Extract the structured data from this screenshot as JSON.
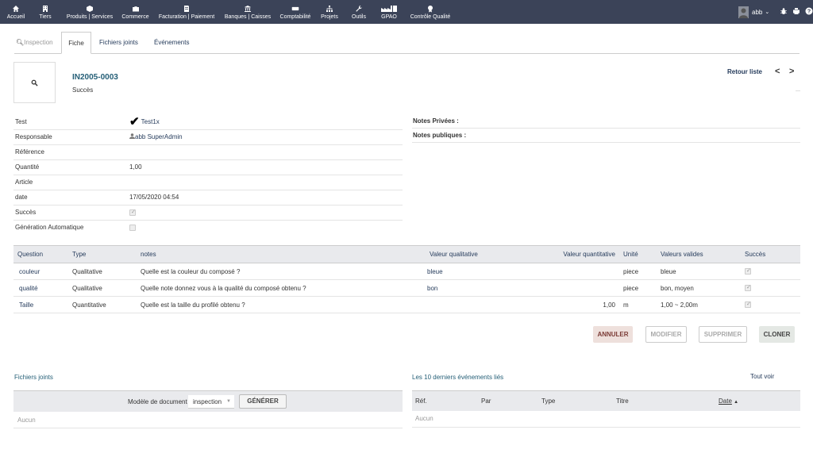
{
  "topmenu": [
    {
      "label": "Accueil",
      "icon": "home-icon"
    },
    {
      "label": "Tiers",
      "icon": "building-icon"
    },
    {
      "label": "Produits | Services",
      "icon": "cube-icon"
    },
    {
      "label": "Commerce",
      "icon": "briefcase-icon"
    },
    {
      "label": "Facturation | Paiement",
      "icon": "invoice-icon"
    },
    {
      "label": "Banques | Caisses",
      "icon": "bank-icon"
    },
    {
      "label": "Comptabilité",
      "icon": "accounting-icon"
    },
    {
      "label": "Projets",
      "icon": "sitemap-icon"
    },
    {
      "label": "Outils",
      "icon": "wrench-icon"
    },
    {
      "label": "GPAO",
      "icon": "factory-icon"
    },
    {
      "label": "Contrôle Qualité",
      "icon": "quality-icon"
    }
  ],
  "user": {
    "name": "abb"
  },
  "tabs": [
    "Inspection",
    "Fiche",
    "Fichiers joints",
    "Événements"
  ],
  "header": {
    "ref": "IN2005-0003",
    "status": "Succès",
    "back": "Retour liste",
    "prev": "<",
    "next": ">"
  },
  "fields": {
    "test": {
      "label": "Test",
      "value": "Test1x"
    },
    "responsable": {
      "label": "Responsable",
      "value": "abb SuperAdmin"
    },
    "reference": {
      "label": "Référence",
      "value": ""
    },
    "quantite": {
      "label": "Quantité",
      "value": "1,00"
    },
    "article": {
      "label": "Article",
      "value": ""
    },
    "date": {
      "label": "date",
      "value": "17/05/2020 04:54"
    },
    "succes": {
      "label": "Succès",
      "checked": true
    },
    "generation": {
      "label": "Génération Automatique",
      "checked": false
    }
  },
  "notes": {
    "private": "Notes Privées :",
    "public": "Notes publiques :"
  },
  "lines": {
    "headers": [
      "Question",
      "Type",
      "notes",
      "Valeur qualitative",
      "Valeur quantitative",
      "Unité",
      "Valeurs valides",
      "Succès"
    ],
    "rows": [
      {
        "question": "couleur",
        "type": "Qualitative",
        "notes": "Quelle est la couleur du composé ?",
        "qual": "bleue",
        "quant": "",
        "unit": "piece",
        "valid": "bleue",
        "success": true
      },
      {
        "question": "qualité",
        "type": "Qualitative",
        "notes": "Quelle note donnez vous à la qualité du composé obtenu ?",
        "qual": "bon",
        "quant": "",
        "unit": "piece",
        "valid": "bon, moyen",
        "success": true
      },
      {
        "question": "Taille",
        "type": "Quantitative",
        "notes": "Quelle est la taille du profilé obtenu ?",
        "qual": "",
        "quant": "1,00",
        "unit": "m",
        "valid": "1,00 ~ 2,00m",
        "success": true
      }
    ]
  },
  "buttons": {
    "cancel": "ANNULER",
    "modify": "MODIFIER",
    "delete": "SUPPRIMER",
    "clone": "CLONER"
  },
  "files": {
    "title": "Fichiers joints",
    "model_label": "Modèle de document",
    "model_value": "inspection",
    "generate": "GÉNÉRER",
    "none": "Aucun"
  },
  "events": {
    "title": "Les 10 derniers événements liés",
    "see_all": "Tout voir",
    "headers": [
      "Réf.",
      "Par",
      "Type",
      "Titre",
      "Date"
    ],
    "none": "Aucun"
  },
  "colors": {
    "topbar": "#3b4358",
    "link": "#263c5c",
    "title": "#255f77",
    "table_header": "#e9eaed"
  }
}
